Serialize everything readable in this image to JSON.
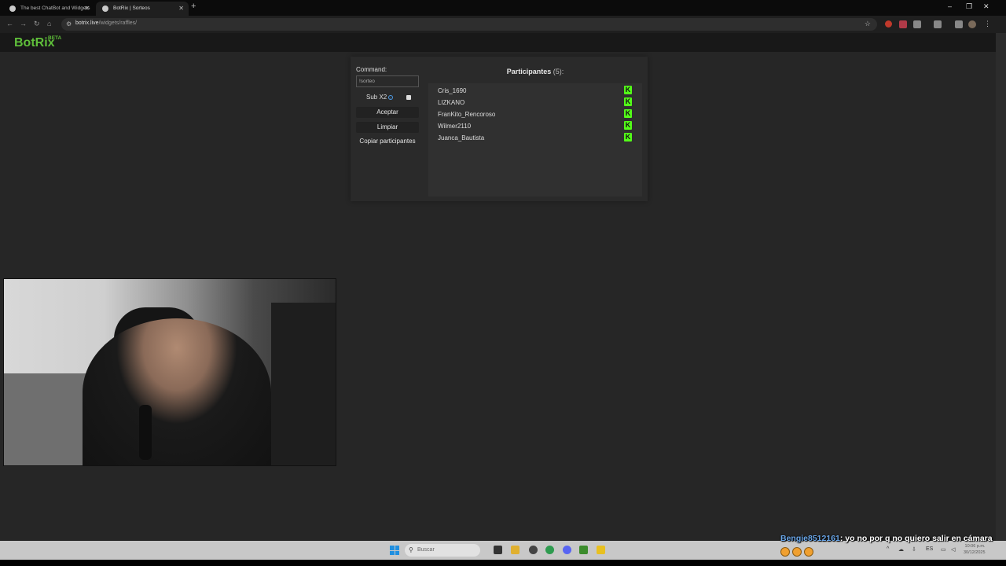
{
  "browser": {
    "tabs": [
      {
        "label": "The best ChatBot and Widgets"
      },
      {
        "label": "BotRix | Sorteos",
        "active": true
      }
    ],
    "new_tab": "+",
    "close_glyph": "✕",
    "address": {
      "domain": "botrix.live",
      "path": "/widgets/raffles/"
    }
  },
  "app": {
    "logo": "BotRix",
    "badge": "BETA"
  },
  "raffle": {
    "command_label": "Command:",
    "command_value": "!sorteo",
    "sub_label": "Sub X2",
    "accept_label": "Aceptar",
    "clear_label": "Limpiar",
    "copy_label": "Copiar participantes",
    "participants_title": "Participantes",
    "participants_count": "(5):",
    "participants": [
      {
        "name": "Cris_1690"
      },
      {
        "name": "LIZKANO"
      },
      {
        "name": "FranKito_Rencoroso"
      },
      {
        "name": "Wilmer2110"
      },
      {
        "name": "Juanca_Bautista"
      }
    ],
    "platform_icon": "kick-icon",
    "platform_glyph": "K",
    "platform_color": "#53fc18"
  },
  "overlay": {
    "chat_user": "Bengie8512161",
    "chat_message": ": yo no por q no quiero salir en cámara"
  },
  "taskbar": {
    "search_placeholder": "Buscar",
    "clock_time": "10:06 p.m.",
    "clock_date": "30/12/2025"
  },
  "colors": {
    "accent": "#5fbf3a",
    "page_bg": "#262626",
    "chat_user": "#6aa6e8"
  }
}
